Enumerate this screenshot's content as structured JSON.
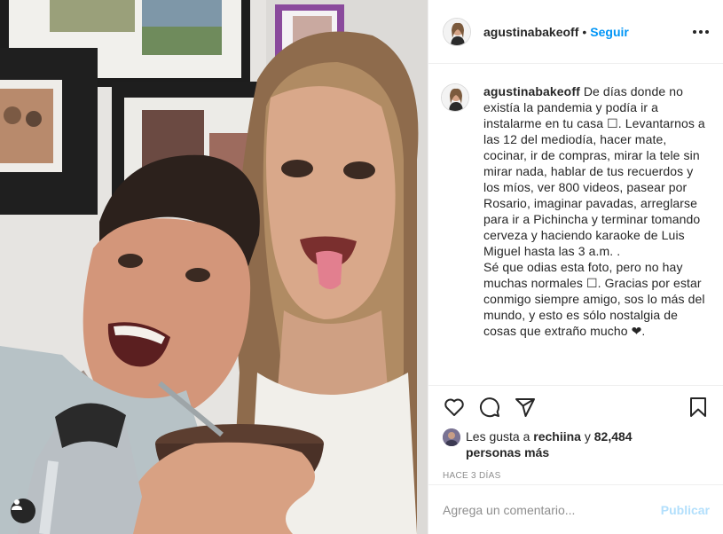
{
  "post": {
    "username": "agustinabakeoff",
    "follow_label": "Seguir",
    "separator": "•"
  },
  "caption": {
    "username": "agustinabakeoff",
    "text": " De días donde no existía la pandemia y podía ir a instalarme en tu casa ☐. Levantarnos a las 12 del mediodía, hacer mate, cocinar, ir de compras, mirar la tele sin mirar nada, hablar de tus recuerdos y los míos, ver 800 videos, pasear por Rosario, imaginar pavadas, arreglarse para ir a Pichincha y terminar tomando cerveza y haciendo karaoke de Luis Miguel hasta las 3 a.m. .\nSé que odias esta foto, pero no hay muchas normales ☐. Gracias por estar conmigo siempre amigo, sos lo más del mundo, y esto es sólo nostalgia de cosas que extraño mucho ❤."
  },
  "actions": {
    "icons": [
      "heart-icon",
      "comment-icon",
      "share-icon",
      "bookmark-icon"
    ]
  },
  "likes": {
    "prefix": "Les gusta a ",
    "user": "rechiina",
    "connector": " y",
    "count": "82,484 personas más"
  },
  "timestamp": "Hace 3 días",
  "comment": {
    "placeholder": "Agrega un comentario...",
    "publish_label": "Publicar"
  },
  "colors": {
    "accent": "#0095f6",
    "publish_disabled": "#b2dffc",
    "text": "#262626",
    "muted": "#8e8e8e"
  }
}
